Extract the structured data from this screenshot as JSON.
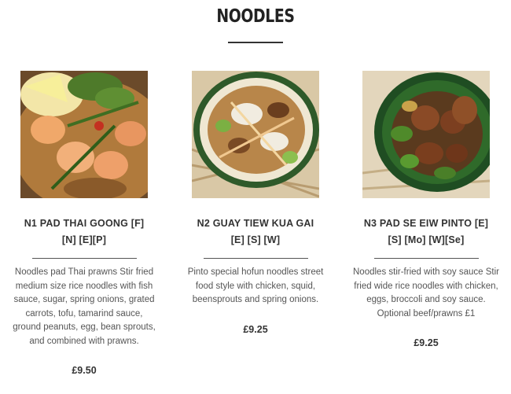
{
  "section": {
    "title": "NOODLES"
  },
  "items": [
    {
      "name_lines": [
        "N1 PAD THAI GOONG [F]",
        "[N] [E][P]"
      ],
      "description": "Noodles pad Thai prawns Stir fried medium size rice noodles with fish sauce, sugar, spring onions, grated carrots, tofu, tamarind sauce, ground peanuts, egg, bean sprouts, and combined with prawns.",
      "price": "£9.50",
      "image_icon": "pad-thai-photo"
    },
    {
      "name_lines": [
        "N2 GUAY TIEW KUA GAI",
        "[E] [S] [W]"
      ],
      "description": "Pinto special hofun noodles street food style with chicken, squid, beensprouts and spring onions.",
      "price": "£9.25",
      "image_icon": "guay-tiew-photo"
    },
    {
      "name_lines": [
        "N3 PAD SE EIW PINTO [E]",
        "[S] [Mo] [W][Se]"
      ],
      "description": "Noodles stir-fried with soy sauce Stir fried wide rice noodles with chicken, eggs, broccoli and soy sauce. Optional beef/prawns £1",
      "price": "£9.25",
      "image_icon": "pad-se-eiw-photo"
    }
  ]
}
